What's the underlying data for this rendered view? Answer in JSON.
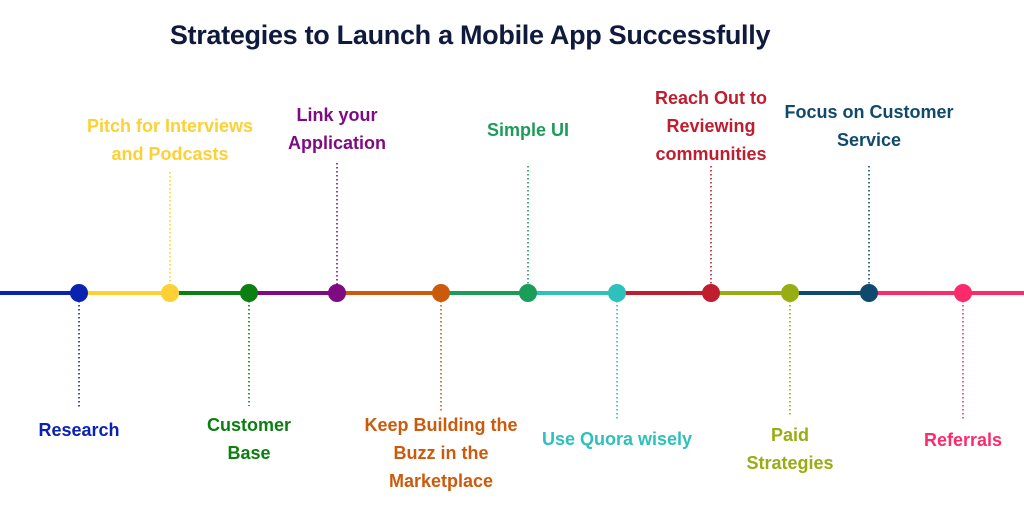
{
  "title": "Strategies to Launch a Mobile App Successfully",
  "steps": [
    {
      "label": "Research",
      "lines": [
        "Research"
      ],
      "position": "below",
      "color": "#0a22b0"
    },
    {
      "label": "Pitch for Interviews and Podcasts",
      "lines": [
        "Pitch for Interviews",
        "and Podcasts"
      ],
      "position": "above",
      "color": "#fdd134"
    },
    {
      "label": "Customer Base",
      "lines": [
        "Customer",
        "Base"
      ],
      "position": "below",
      "color": "#0b7f10"
    },
    {
      "label": "Link your Application",
      "lines": [
        "Link your",
        "Application"
      ],
      "position": "above",
      "color": "#7e0b82"
    },
    {
      "label": "Keep Building the Buzz in the Marketplace",
      "lines": [
        "Keep Building the",
        "Buzz in the",
        "Marketplace"
      ],
      "position": "below",
      "color": "#cc5a0d"
    },
    {
      "label": "Simple UI",
      "lines": [
        "Simple UI"
      ],
      "position": "above",
      "color": "#1c9c59"
    },
    {
      "label": "Use Quora wisely",
      "lines": [
        "Use Quora wisely"
      ],
      "position": "below",
      "color": "#2ec0bd"
    },
    {
      "label": "Reach Out to Reviewing communities",
      "lines": [
        "Reach Out to",
        "Reviewing",
        "communities"
      ],
      "position": "above",
      "color": "#c01d2e"
    },
    {
      "label": "Paid Strategies",
      "lines": [
        "Paid",
        "Strategies"
      ],
      "position": "below",
      "color": "#97ad12"
    },
    {
      "label": "Focus on Customer Service",
      "lines": [
        "Focus on Customer",
        "Service"
      ],
      "position": "above",
      "color": "#0f4a6e"
    },
    {
      "label": "Referrals",
      "lines": [
        "Referrals"
      ],
      "position": "below",
      "color": "#fb2b6b"
    }
  ]
}
